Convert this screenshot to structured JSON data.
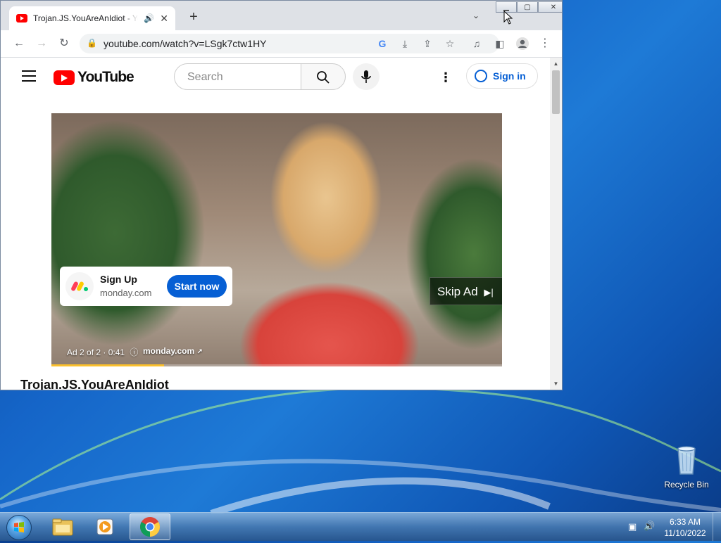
{
  "browser": {
    "tab_title": "Trojan.JS.YouAreAnIdiot - YouTube",
    "url": "youtube.com/watch?v=LSgk7ctw1HY"
  },
  "youtube": {
    "logo_text": "YouTube",
    "search_placeholder": "Search",
    "sign_in": "Sign in",
    "video_title": "Trojan.JS.YouAreAnIdiot"
  },
  "ad": {
    "card_name": "Sign Up",
    "card_domain": "monday.com",
    "cta": "Start now",
    "skip": "Skip Ad",
    "info": "Ad 2 of 2 · 0:41",
    "domain": "monday.com",
    "progress": 0.25
  },
  "desktop": {
    "recycle_bin": "Recycle Bin"
  },
  "taskbar": {
    "time": "6:33 AM",
    "date": "11/10/2022"
  },
  "colors": {
    "youtube_red": "#ff0000",
    "link_blue": "#065fd4",
    "ad_progress": "#fbc02d"
  }
}
